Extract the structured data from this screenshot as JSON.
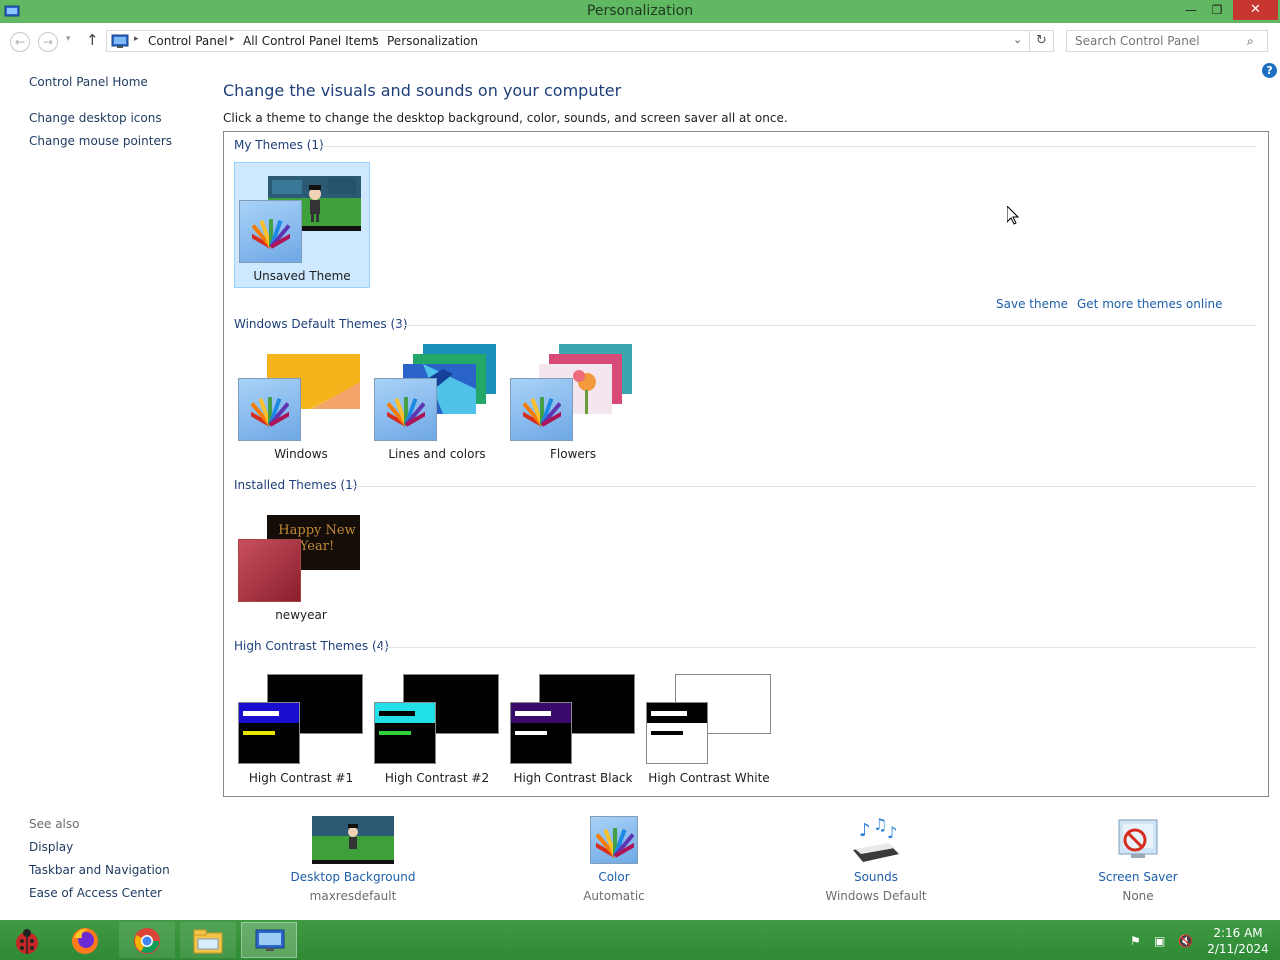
{
  "window": {
    "title": "Personalization",
    "minimize_glyph": "—",
    "restore_glyph": "❐",
    "close_glyph": "✕"
  },
  "address": {
    "crumbs": [
      "Control Panel",
      "All Control Panel Items",
      "Personalization"
    ],
    "search_placeholder": "Search Control Panel"
  },
  "sidebar": {
    "home": "Control Panel Home",
    "links": [
      "Change desktop icons",
      "Change mouse pointers"
    ],
    "see_also_header": "See also",
    "see_also": [
      "Display",
      "Taskbar and Navigation",
      "Ease of Access Center"
    ]
  },
  "main": {
    "heading": "Change the visuals and sounds on your computer",
    "subtitle": "Click a theme to change the desktop background, color, sounds, and screen saver all at once.",
    "save_theme": "Save theme",
    "get_more": "Get more themes online"
  },
  "groups": {
    "my_themes": {
      "header": "My Themes (1)",
      "tiles": [
        "Unsaved Theme"
      ]
    },
    "windows_default": {
      "header": "Windows Default Themes (3)",
      "tiles": [
        "Windows",
        "Lines and colors",
        "Flowers"
      ]
    },
    "installed": {
      "header": "Installed Themes (1)",
      "tiles": [
        "newyear"
      ],
      "wallpaper_text": "Happy New Year!"
    },
    "high_contrast": {
      "header": "High Contrast Themes (4)",
      "tiles": [
        "High Contrast #1",
        "High Contrast #2",
        "High Contrast Black",
        "High Contrast White"
      ]
    }
  },
  "settings": [
    {
      "title": "Desktop Background",
      "value": "maxresdefault"
    },
    {
      "title": "Color",
      "value": "Automatic"
    },
    {
      "title": "Sounds",
      "value": "Windows Default"
    },
    {
      "title": "Screen Saver",
      "value": "None"
    }
  ],
  "taskbar": {
    "time": "2:16 AM",
    "date": "2/11/2024",
    "apps": [
      "ladybug-icon",
      "firefox-icon",
      "chrome-icon",
      "file-explorer-icon",
      "control-panel-icon"
    ]
  },
  "colors": {
    "titlebar": "#61b863",
    "taskbar": "#3a9640",
    "link": "#1d5fa8",
    "heading": "#1e3f7a",
    "selected_tile": "#cde8ff"
  }
}
